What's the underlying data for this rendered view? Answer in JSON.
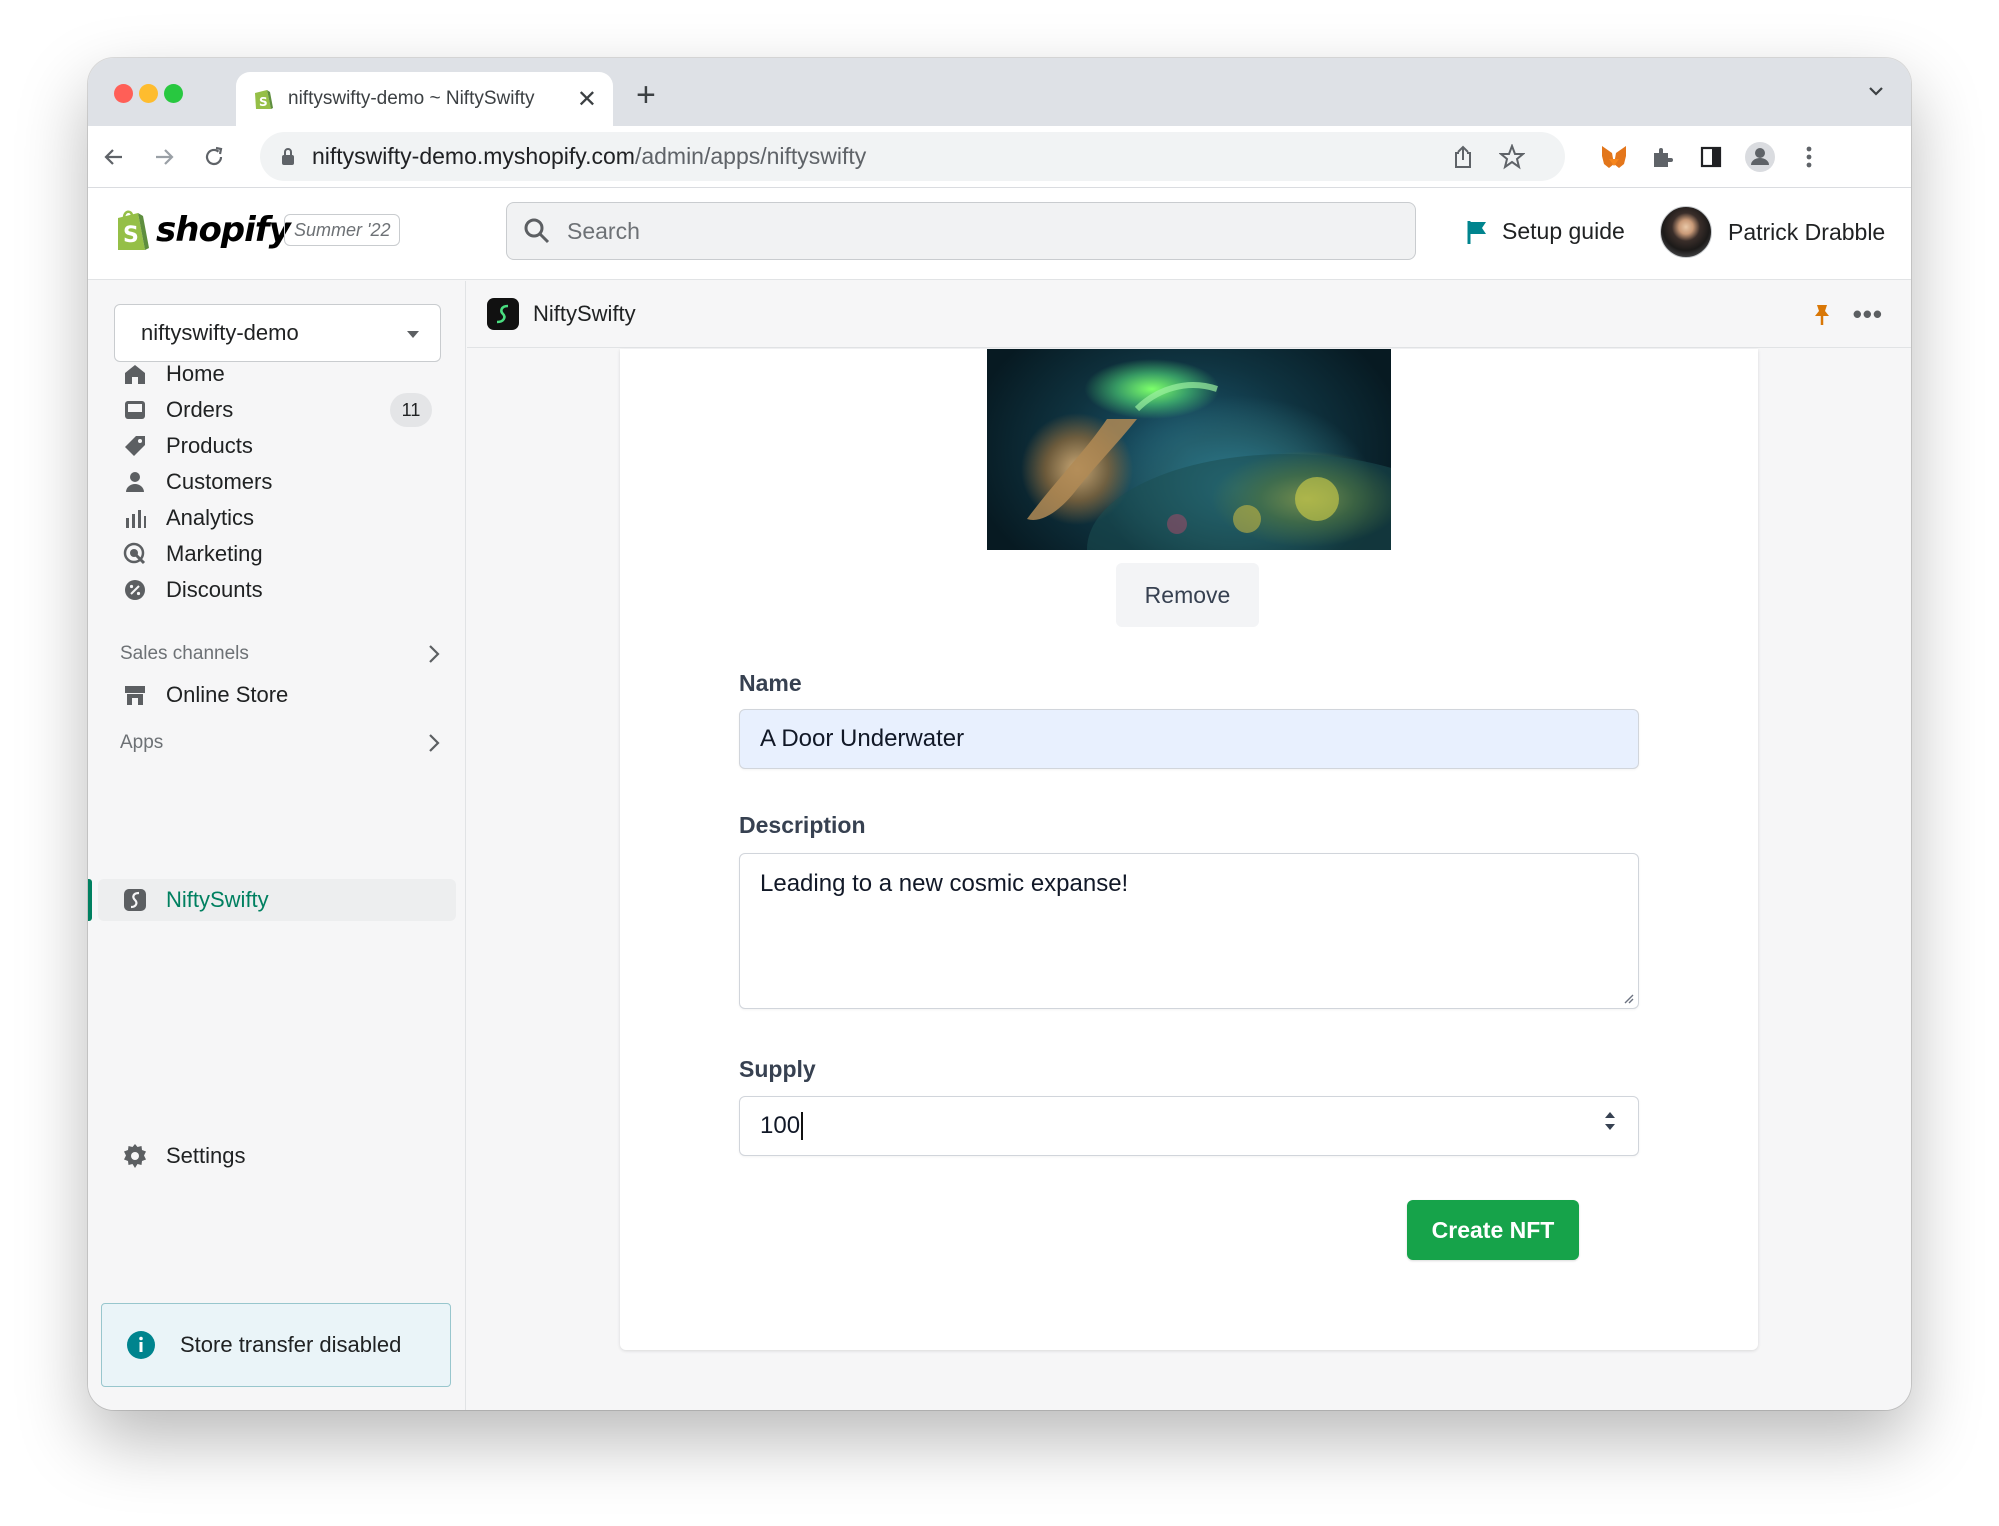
{
  "browser": {
    "tab_title": "niftyswifty-demo ~ NiftySwifty",
    "tab_close": "✕",
    "new_tab": "+",
    "url_host": "niftyswifty-demo.myshopify.com",
    "url_path": "/admin/apps/niftyswifty"
  },
  "header": {
    "logo_text": "shopify",
    "edition": "Summer '22",
    "search_placeholder": "Search",
    "setup_guide": "Setup guide",
    "user_name": "Patrick Drabble"
  },
  "sidebar": {
    "store_name": "niftyswifty-demo",
    "items": [
      {
        "label": "Home",
        "icon": "home-icon"
      },
      {
        "label": "Orders",
        "icon": "orders-icon",
        "badge": "11"
      },
      {
        "label": "Products",
        "icon": "tag-icon"
      },
      {
        "label": "Customers",
        "icon": "person-icon"
      },
      {
        "label": "Analytics",
        "icon": "bar-chart-icon"
      },
      {
        "label": "Marketing",
        "icon": "target-icon"
      },
      {
        "label": "Discounts",
        "icon": "discount-icon"
      }
    ],
    "sales_channels_title": "Sales channels",
    "online_store": "Online Store",
    "apps_title": "Apps",
    "active_app": "NiftySwifty",
    "settings": "Settings",
    "notice": "Store transfer disabled"
  },
  "app": {
    "title": "NiftySwifty",
    "dots": "•••"
  },
  "form": {
    "remove_label": "Remove",
    "name_label": "Name",
    "name_value": "A Door Underwater",
    "description_label": "Description",
    "description_value": "Leading to a new cosmic expanse!",
    "supply_label": "Supply",
    "supply_value": "100",
    "submit_label": "Create NFT"
  },
  "colors": {
    "accent_green": "#16a34a",
    "shopify_green": "#008060",
    "autofill_blue": "#e8f0fe"
  }
}
